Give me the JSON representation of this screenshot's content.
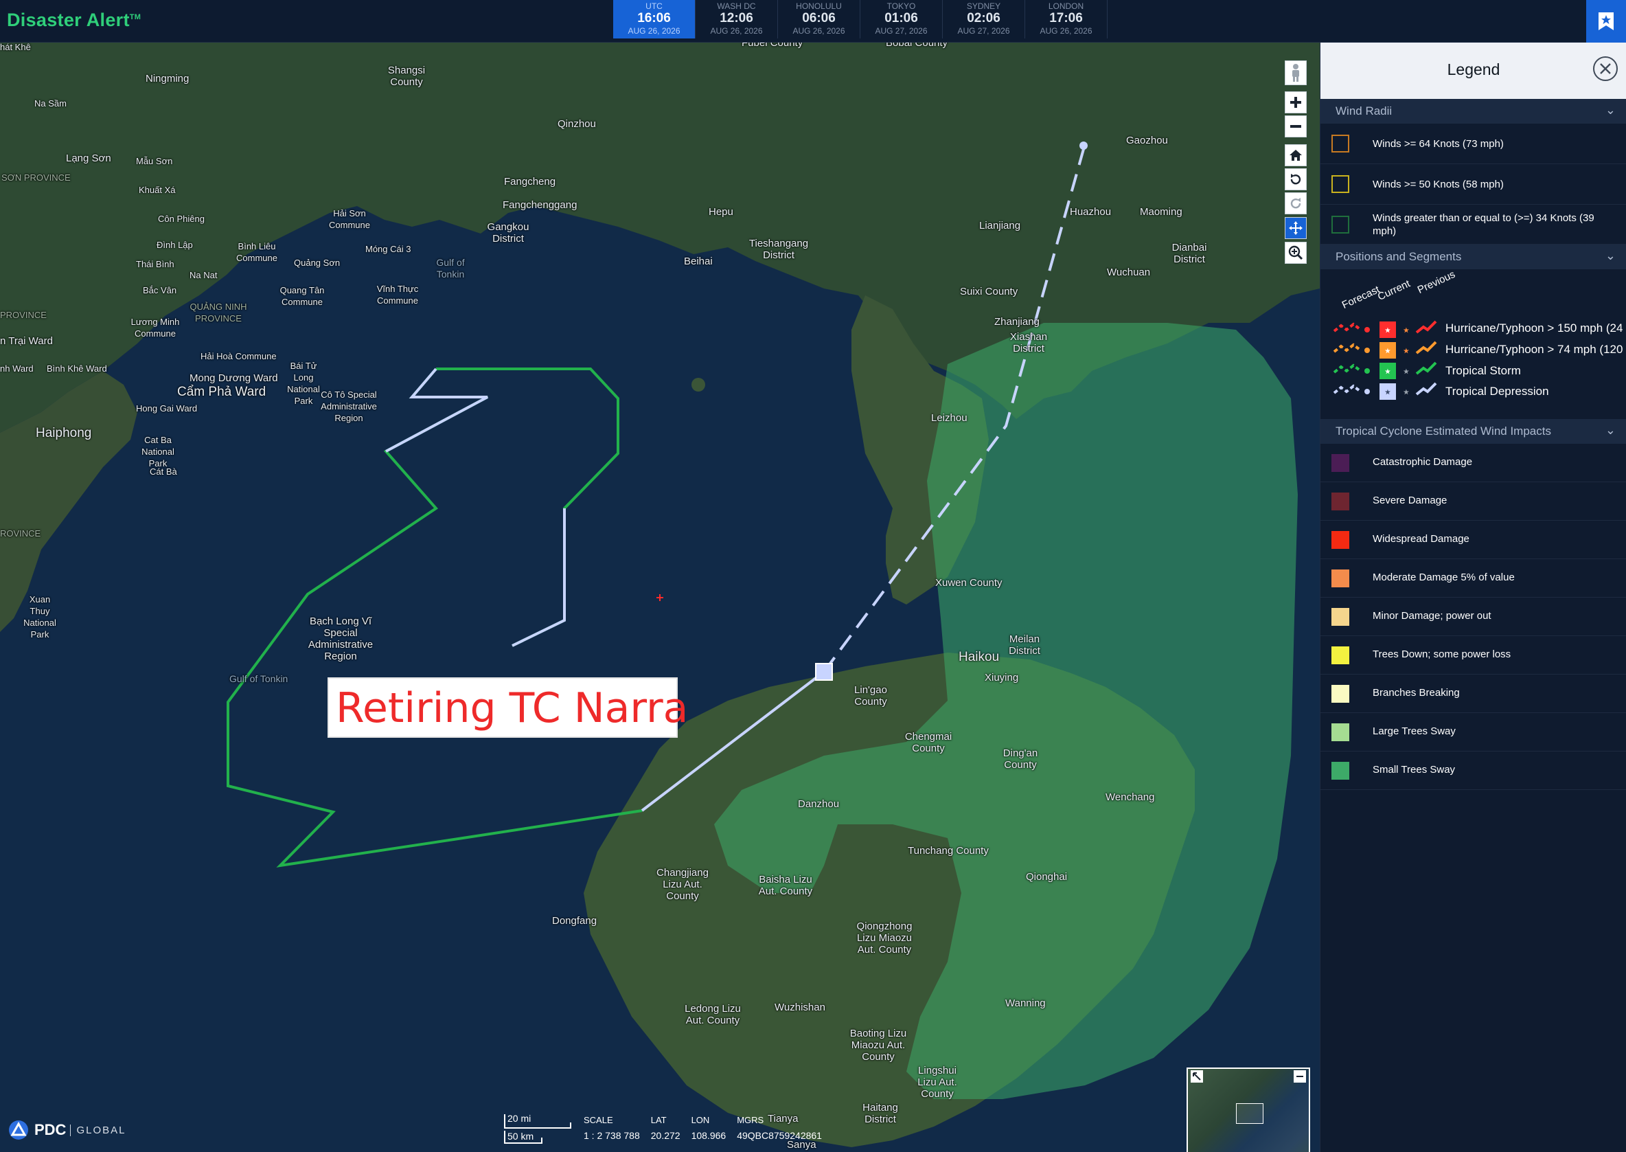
{
  "app": {
    "title": "Disaster Alert",
    "trademark": "TM"
  },
  "clocks": [
    {
      "city": "UTC",
      "time": "16:06",
      "date": "AUG 26, 2026",
      "active": true
    },
    {
      "city": "WASH DC",
      "time": "12:06",
      "date": "AUG 26, 2026"
    },
    {
      "city": "HONOLULU",
      "time": "06:06",
      "date": "AUG 26, 2026"
    },
    {
      "city": "TOKYO",
      "time": "01:06",
      "date": "AUG 27, 2026"
    },
    {
      "city": "SYDNEY",
      "time": "02:06",
      "date": "AUG 27, 2026"
    },
    {
      "city": "LONDON",
      "time": "17:06",
      "date": "AUG 26, 2026"
    }
  ],
  "map": {
    "overlay_label": "Retiring TC Narra",
    "places": [
      {
        "name": "Fubei County",
        "cls": ""
      },
      {
        "name": "Bobai County",
        "cls": ""
      },
      {
        "name": "Ningming",
        "cls": ""
      },
      {
        "name": "Shangsi County",
        "cls": ""
      },
      {
        "name": "Na Sầm",
        "cls": "small"
      },
      {
        "name": "Qinzhou",
        "cls": ""
      },
      {
        "name": "Gaozhou",
        "cls": ""
      },
      {
        "name": "Lạng Sơn",
        "cls": ""
      },
      {
        "name": "Mẫu Sơn",
        "cls": "small"
      },
      {
        "name": "SƠN PROVINCE",
        "cls": "small"
      },
      {
        "name": "Fangcheng",
        "cls": ""
      },
      {
        "name": "Fangchenggang",
        "cls": ""
      },
      {
        "name": "Hepu",
        "cls": ""
      },
      {
        "name": "Huazhou",
        "cls": ""
      },
      {
        "name": "Maoming",
        "cls": ""
      },
      {
        "name": "Khuất Xá",
        "cls": "small"
      },
      {
        "name": "Côn Phiêng",
        "cls": "small"
      },
      {
        "name": "Hải Sơn Commune",
        "cls": "small"
      },
      {
        "name": "Gangkou District",
        "cls": ""
      },
      {
        "name": "Lianjiang",
        "cls": ""
      },
      {
        "name": "Đình Lập",
        "cls": "small"
      },
      {
        "name": "Bình Liêu Commune",
        "cls": "small"
      },
      {
        "name": "Móng Cái 3",
        "cls": "small"
      },
      {
        "name": "Tieshangang District",
        "cls": ""
      },
      {
        "name": "Dianbai District",
        "cls": ""
      },
      {
        "name": "Thái Bình",
        "cls": "small"
      },
      {
        "name": "Quảng Sơn",
        "cls": "small"
      },
      {
        "name": "Gulf of Tonkin",
        "cls": "water"
      },
      {
        "name": "Beihai",
        "cls": ""
      },
      {
        "name": "Wuchuan",
        "cls": ""
      },
      {
        "name": "Na Nat",
        "cls": "small"
      },
      {
        "name": "Bắc Vân",
        "cls": "small"
      },
      {
        "name": "Quang Tân Commune",
        "cls": "small"
      },
      {
        "name": "Vĩnh Thực Commune",
        "cls": "small"
      },
      {
        "name": "Suixi County",
        "cls": ""
      },
      {
        "name": "QUẢNG NINH PROVINCE",
        "cls": "small"
      },
      {
        "name": "PROVINCE",
        "cls": "small"
      },
      {
        "name": "Lương Minh Commune",
        "cls": "small"
      },
      {
        "name": "Zhanjiang",
        "cls": ""
      },
      {
        "name": "Xiashan District",
        "cls": ""
      },
      {
        "name": "n Trại Ward",
        "cls": ""
      },
      {
        "name": "Hải Hoà Commune",
        "cls": "small"
      },
      {
        "name": "nh Ward",
        "cls": "small"
      },
      {
        "name": "Bình Khê Ward",
        "cls": "small"
      },
      {
        "name": "Bái Tử Long National Park",
        "cls": "small"
      },
      {
        "name": "Mong Dương Ward",
        "cls": ""
      },
      {
        "name": "Cẩm Phả Ward",
        "cls": "big"
      },
      {
        "name": "Cô Tô Special Administrative Region",
        "cls": "small"
      },
      {
        "name": "Hong Gai Ward",
        "cls": "small"
      },
      {
        "name": "Leizhou",
        "cls": ""
      },
      {
        "name": "Haiphong",
        "cls": "big"
      },
      {
        "name": "Cat Ba National Park",
        "cls": "small"
      },
      {
        "name": "Cát Bà",
        "cls": "small"
      },
      {
        "name": "ROVINCE",
        "cls": "small"
      },
      {
        "name": "Xuwen County",
        "cls": ""
      },
      {
        "name": "Xuan Thuy National Park",
        "cls": "small"
      },
      {
        "name": "Bạch Long Vĩ Special Administrative Region",
        "cls": ""
      },
      {
        "name": "Meilan District",
        "cls": ""
      },
      {
        "name": "Haikou",
        "cls": "big"
      },
      {
        "name": "Gulf of Tonkin",
        "cls": "water"
      },
      {
        "name": "Xiuying",
        "cls": ""
      },
      {
        "name": "Lin'gao County",
        "cls": ""
      },
      {
        "name": "Chengmai County",
        "cls": ""
      },
      {
        "name": "Ding'an County",
        "cls": ""
      },
      {
        "name": "Wenchang",
        "cls": ""
      },
      {
        "name": "Danzhou",
        "cls": ""
      },
      {
        "name": "Tunchang County",
        "cls": ""
      },
      {
        "name": "Changjiang Lizu Aut. County",
        "cls": ""
      },
      {
        "name": "Baisha Lizu Aut. County",
        "cls": ""
      },
      {
        "name": "Qionghai",
        "cls": ""
      },
      {
        "name": "Dongfang",
        "cls": ""
      },
      {
        "name": "Qiongzhong Lizu Miaozu Aut. County",
        "cls": ""
      },
      {
        "name": "Wanning",
        "cls": ""
      },
      {
        "name": "Ledong Lizu Aut. County",
        "cls": ""
      },
      {
        "name": "Wuzhishan",
        "cls": ""
      },
      {
        "name": "Baoting Lizu Miaozu Aut. County",
        "cls": ""
      },
      {
        "name": "Lingshui Lizu Aut. County",
        "cls": ""
      },
      {
        "name": "Haitang District",
        "cls": ""
      },
      {
        "name": "Tianya",
        "cls": ""
      },
      {
        "name": "Sanya",
        "cls": ""
      },
      {
        "name": "hát Khê",
        "cls": "small"
      }
    ]
  },
  "footer": {
    "logo": "PDC",
    "logo_sub": "GLOBAL",
    "scale_top": "20 mi",
    "scale_bottom": "50 km",
    "scale_label": "SCALE",
    "scale_value": "1 : 2 738 788",
    "lat_label": "LAT",
    "lat_value": "20.272",
    "lon_label": "LON",
    "lon_value": "108.966",
    "mgrs_label": "MGRS",
    "mgrs_value": "49QBC8759242861"
  },
  "legend": {
    "title": "Legend",
    "wind_radii": {
      "title": "Wind Radii",
      "items": [
        {
          "label": "Winds >= 64 Knots (73 mph)",
          "color": "#c77a22"
        },
        {
          "label": "Winds >= 50 Knots (58 mph)",
          "color": "#c9b21e"
        },
        {
          "label": "Winds greater than or equal to (>=) 34 Knots (39 mph)",
          "color": "#1f6e3c"
        }
      ]
    },
    "positions": {
      "title": "Positions and Segments",
      "headers": [
        "Forecast",
        "Current",
        "Previous"
      ],
      "items": [
        {
          "label": "Hurricane/Typhoon > 150 mph (24",
          "color": "#ff2e2e"
        },
        {
          "label": "Hurricane/Typhoon > 74 mph (120",
          "color": "#ff9a2e"
        },
        {
          "label": "Tropical Storm",
          "color": "#23c451"
        },
        {
          "label": "Tropical Depression",
          "color": "#c8d4ff"
        }
      ]
    },
    "impacts": {
      "title": "Tropical Cyclone Estimated Wind Impacts",
      "items": [
        {
          "label": "Catastrophic Damage",
          "color": "#4b1d55"
        },
        {
          "label": "Severe Damage",
          "color": "#6e2530"
        },
        {
          "label": "Widespread Damage",
          "color": "#f42a12"
        },
        {
          "label": "Moderate Damage 5% of value",
          "color": "#f48c4c"
        },
        {
          "label": "Minor Damage; power out",
          "color": "#f5d58d"
        },
        {
          "label": "Trees Down; some power loss",
          "color": "#f3f240"
        },
        {
          "label": "Branches Breaking",
          "color": "#fafac2"
        },
        {
          "label": "Large Trees Sway",
          "color": "#a5dc92"
        },
        {
          "label": "Small Trees Sway",
          "color": "#3daa68"
        }
      ]
    }
  }
}
